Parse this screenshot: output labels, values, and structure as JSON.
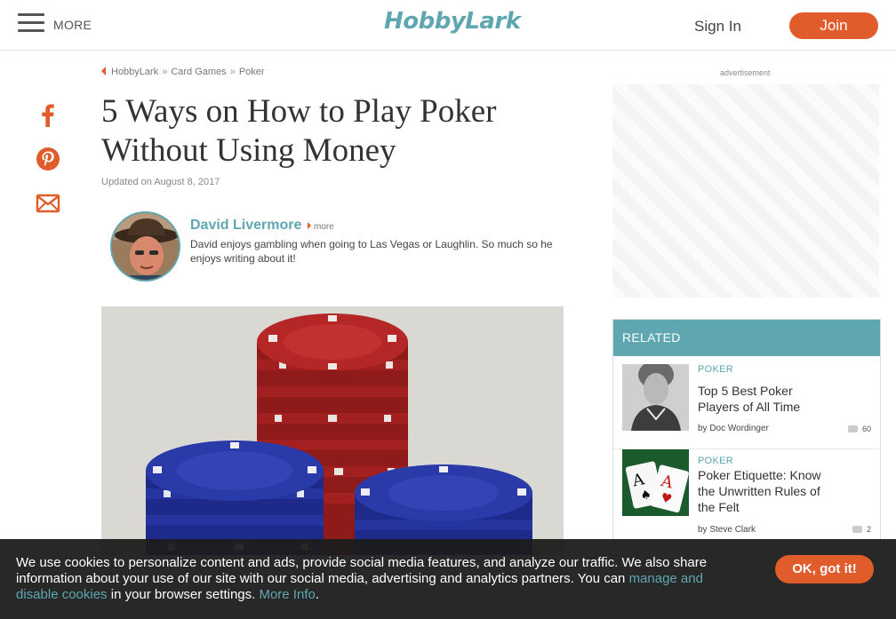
{
  "header": {
    "menu_label": "MORE",
    "logo_text": "HobbyLark",
    "signin_label": "Sign In",
    "join_label": "Join"
  },
  "colors": {
    "brand": "#5fa7b0",
    "accent": "#e05d2b",
    "cookie_bg": "#1c1c1c"
  },
  "social": {
    "icons": [
      "facebook-icon",
      "pinterest-icon",
      "email-icon"
    ]
  },
  "breadcrumb": {
    "items": [
      "HobbyLark",
      "Card Games",
      "Poker"
    ],
    "separator": "»"
  },
  "article": {
    "title": "5 Ways on How to Play Poker Without Using Money",
    "updated": "Updated on August 8, 2017",
    "author": {
      "name": "David Livermore",
      "more_label": "more",
      "bio": "David enjoys gambling when going to Las Vegas or Laughlin. So much so he enjoys writing about it!"
    }
  },
  "ad": {
    "label": "advertisement"
  },
  "related": {
    "heading": "RELATED",
    "items": [
      {
        "category": "POKER",
        "title": "Top 5 Best Poker Players of All Time",
        "byline": "by Doc Wordinger",
        "comments": "60"
      },
      {
        "category": "POKER",
        "title": "Poker Etiquette: Know the Unwritten Rules of the Felt",
        "byline": "by Steve Clark",
        "comments": "2"
      }
    ]
  },
  "cookie": {
    "text_before": "We use cookies to personalize content and ads, provide social media features, and analyze our traffic. We also share information about your use of our site with our social media, advertising and analytics partners. You can ",
    "manage_link": "manage and disable cookies",
    "text_middle": " in your browser settings. ",
    "more_info_link": "More Info",
    "text_after": ".",
    "button_label": "OK, got it!"
  }
}
